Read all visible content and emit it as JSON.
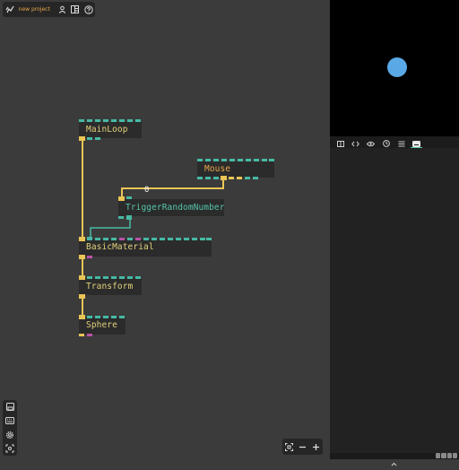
{
  "topbar": {
    "project_name": "new project",
    "buttons": [
      "user-icon",
      "layout-icon",
      "help-icon"
    ]
  },
  "left_toolbar": {
    "buttons": [
      "save-icon",
      "keyboard-icon",
      "settings-icon",
      "fullscreen-icon"
    ]
  },
  "zoom_toolbar": {
    "buttons": [
      "fit-view-icon",
      "zoom-out-icon",
      "zoom-in-icon"
    ]
  },
  "right_panel": {
    "tabs": [
      "book-icon",
      "code-icon",
      "eye-icon",
      "clock-icon",
      "list-icon",
      "keyboard-icon"
    ],
    "active_tab_index": 5
  },
  "colors": {
    "canvas_bg": "#3b3b3b",
    "node_bg": "#2b2b2b",
    "node_text_default": "#e2d27c",
    "node_text_mouse": "#e8a64b",
    "node_text_trigger": "#54c4a8",
    "port_teal": "#47b9a4",
    "port_pink": "#b952a8",
    "port_yellow": "#e9c556",
    "sphere_color": "#5aa9e6"
  },
  "nodes": {
    "mainloop": "MainLoop",
    "mouse": "Mouse",
    "trigger": "TriggerRandomNumber",
    "basicmaterial": "BasicMaterial",
    "transform": "Transform",
    "sphere": "Sphere"
  },
  "link_value": "0"
}
